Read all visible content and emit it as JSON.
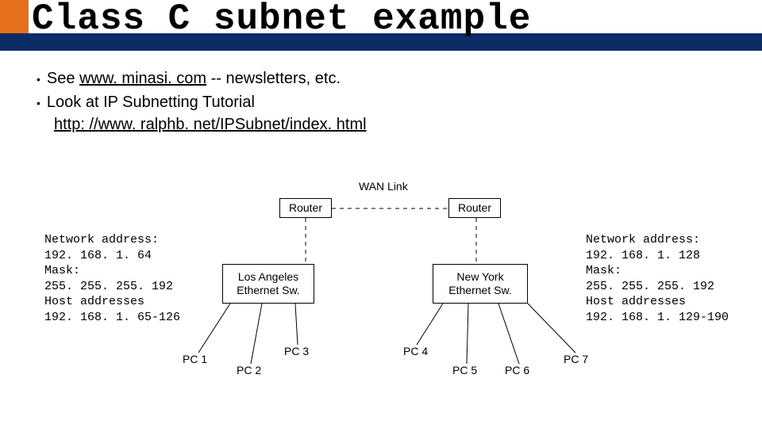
{
  "title": "Class C subnet example",
  "bullets": {
    "b1_prefix": "See ",
    "b1_link": "www. minasi. com",
    "b1_suffix": " -- newsletters, etc.",
    "b2": "Look at IP Subnetting Tutorial",
    "b2_link": "http: //www. ralphb. net/IPSubnet/index. html"
  },
  "diagram": {
    "wan_label": "WAN Link",
    "router_left": "Router",
    "router_right": "Router",
    "switch_left_l1": "Los Angeles",
    "switch_left_l2": "Ethernet Sw.",
    "switch_right_l1": "New York",
    "switch_right_l2": "Ethernet Sw.",
    "pc1": "PC 1",
    "pc2": "PC 2",
    "pc3": "PC 3",
    "pc4": "PC 4",
    "pc5": "PC 5",
    "pc6": "PC 6",
    "pc7": "PC 7",
    "net_left": "Network address:\n192. 168. 1. 64\nMask:\n255. 255. 255. 192\nHost addresses\n192. 168. 1. 65-126",
    "net_right": "Network address:\n192. 168. 1. 128\nMask:\n255. 255. 255. 192\nHost addresses\n192. 168. 1. 129-190"
  }
}
